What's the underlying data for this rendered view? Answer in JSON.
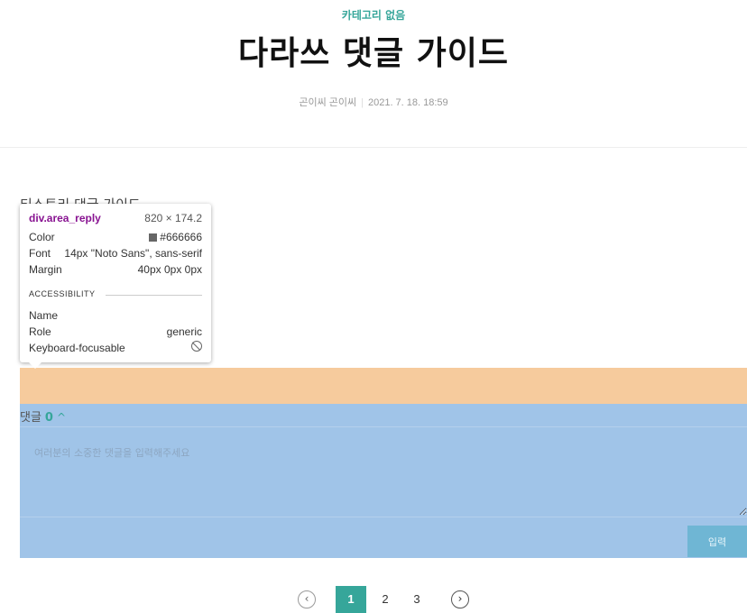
{
  "post": {
    "category": "카테고리 없음",
    "title": "다라쓰 댓글 가이드",
    "author": "곤이씨 곤이씨",
    "date": "2021. 7. 18. 18:59",
    "body_text": "티스토리 댓글 가이드"
  },
  "reply": {
    "label": "댓글",
    "count": "0",
    "toggle_glyph": "^",
    "placeholder": "여러분의 소중한 댓글을 입력해주세요",
    "submit_label": "입력"
  },
  "pagination": {
    "prev_glyph": "‹",
    "next_glyph": "›",
    "pages": [
      "1",
      "2",
      "3"
    ],
    "current": "1"
  },
  "inspector": {
    "selector": "div.area_reply",
    "dimensions": "820 × 174.2",
    "rows": [
      {
        "key": "Color",
        "value": "#666666"
      },
      {
        "key": "Font",
        "value": "14px \"Noto Sans\", sans-serif"
      },
      {
        "key": "Margin",
        "value": "40px 0px 0px"
      }
    ],
    "section_label": "ACCESSIBILITY",
    "accessibility": [
      {
        "key": "Name",
        "value": ""
      },
      {
        "key": "Role",
        "value": "generic"
      },
      {
        "key": "Keyboard-focusable",
        "value": ""
      }
    ]
  },
  "colors": {
    "accent": "#36a69a",
    "margin_overlay": "#f6cb9d",
    "content_overlay": "#a0c4e8"
  }
}
